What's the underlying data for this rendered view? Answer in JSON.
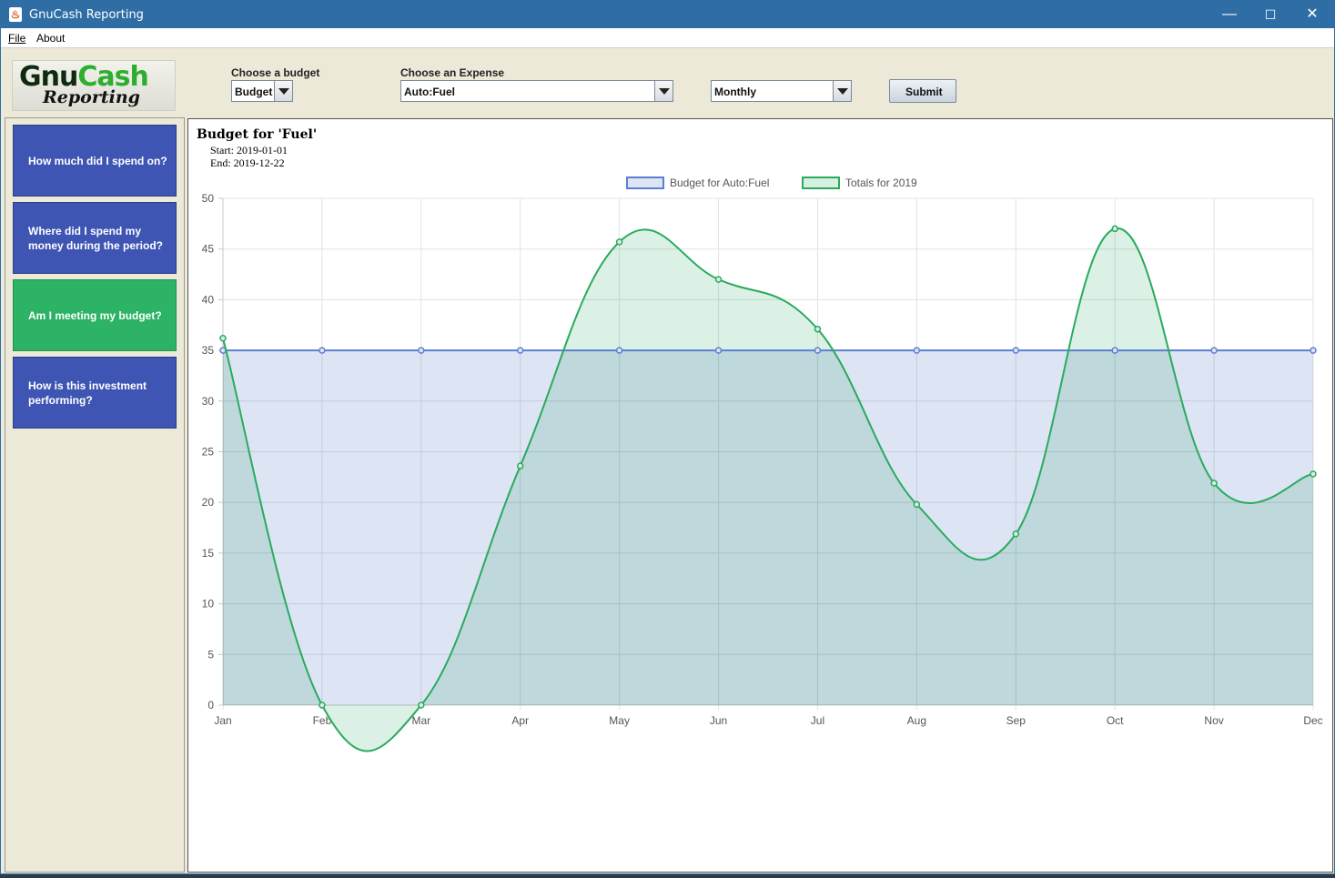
{
  "window": {
    "title": "GnuCash Reporting",
    "controls": {
      "minimize": "—",
      "maximize": "☐",
      "close": "✕"
    }
  },
  "menu": {
    "file": "File",
    "about": "About"
  },
  "logo": {
    "line1a": "Gnu",
    "line1b": "Cash",
    "line2": "Reporting"
  },
  "toolbar": {
    "budget_label": "Choose a budget",
    "budget_value": "Budget",
    "expense_label": "Choose an Expense",
    "expense_value": "Auto:Fuel",
    "period_value": "Monthly",
    "submit_label": "Submit"
  },
  "sidebar": {
    "items": [
      {
        "label": "How much did I spend on?",
        "active": false
      },
      {
        "label": "Where did I spend my money during the period?",
        "active": false
      },
      {
        "label": "Am I meeting my budget?",
        "active": true
      },
      {
        "label": "How is this investment performing?",
        "active": false
      }
    ]
  },
  "report": {
    "title": "Budget for 'Fuel'",
    "start": "Start: 2019-01-01",
    "end": "End: 2019-12-22"
  },
  "chart_data": {
    "type": "line",
    "title": "",
    "xlabel": "",
    "ylabel": "",
    "categories": [
      "Jan",
      "Feb",
      "Mar",
      "Apr",
      "May",
      "Jun",
      "Jul",
      "Aug",
      "Sep",
      "Oct",
      "Nov",
      "Dec"
    ],
    "ylim": [
      0,
      50
    ],
    "yticks": [
      0,
      5,
      10,
      15,
      20,
      25,
      30,
      35,
      40,
      45,
      50
    ],
    "grid": true,
    "legend_position": "top-center",
    "series": [
      {
        "name": "Budget for Auto:Fuel",
        "color": "#5b7fd1",
        "fill": "#dde5f5",
        "values": [
          35,
          35,
          35,
          35,
          35,
          35,
          35,
          35,
          35,
          35,
          35,
          35
        ]
      },
      {
        "name": "Totals for 2019",
        "color": "#2aaa5e",
        "fill": "#d5efe0",
        "values": [
          36.2,
          0,
          0,
          23.6,
          45.7,
          42,
          37.1,
          19.8,
          16.9,
          47,
          21.9,
          22.8
        ]
      }
    ]
  }
}
